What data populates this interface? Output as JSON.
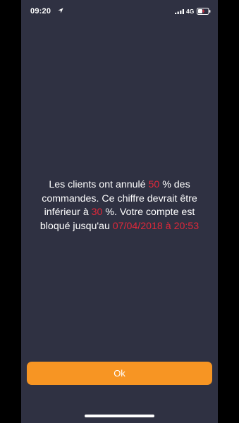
{
  "status_bar": {
    "time": "09:20",
    "network": "4G",
    "icons": [
      "location-arrow-icon",
      "signal-icon",
      "battery-charging-icon"
    ]
  },
  "message": {
    "part1": "Les clients ont annulé ",
    "cancel_rate": "50",
    "part2": " % des commandes. Ce chiffre devrait être inférieur à ",
    "max_rate": "30",
    "part3": " %. Votre compte est bloqué jusqu'au ",
    "blocked_until": "07/04/2018 à 20:53"
  },
  "ok_button": {
    "label": "Ok"
  },
  "colors": {
    "background": "#2f3142",
    "highlight": "#e0283a",
    "button": "#f79523"
  }
}
